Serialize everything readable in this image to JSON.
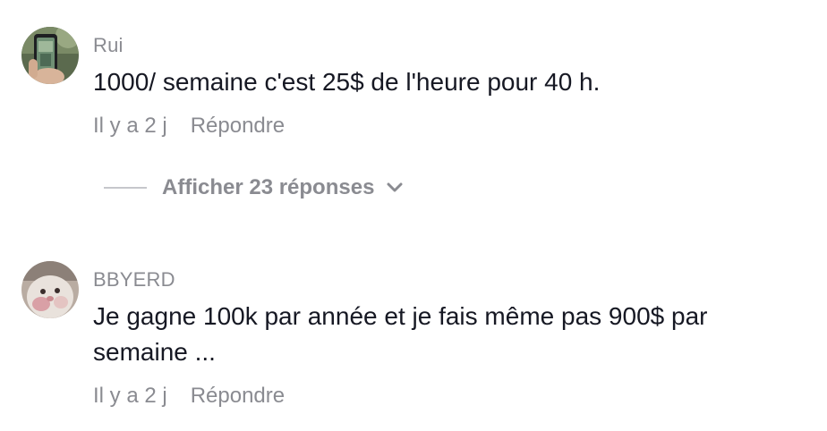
{
  "comments": [
    {
      "username": "Rui",
      "text": "1000/ semaine c'est 25$ de l'heure pour 40 h.",
      "time": "Il y a 2 j",
      "reply_label": "Répondre",
      "avatar_icon": "phone-photo-avatar"
    },
    {
      "username": "BBYERD",
      "text": "Je gagne 100k par année et je fais même pas 900$ par semaine ...",
      "time": "Il y a 2 j",
      "reply_label": "Répondre",
      "avatar_icon": "pet-photo-avatar"
    }
  ],
  "view_replies": {
    "label": "Afficher 23 réponses",
    "icon": "chevron-down-icon"
  },
  "colors": {
    "text": "#161823",
    "muted": "#8a8b91",
    "divider": "#c6c7cb",
    "background": "#ffffff"
  }
}
